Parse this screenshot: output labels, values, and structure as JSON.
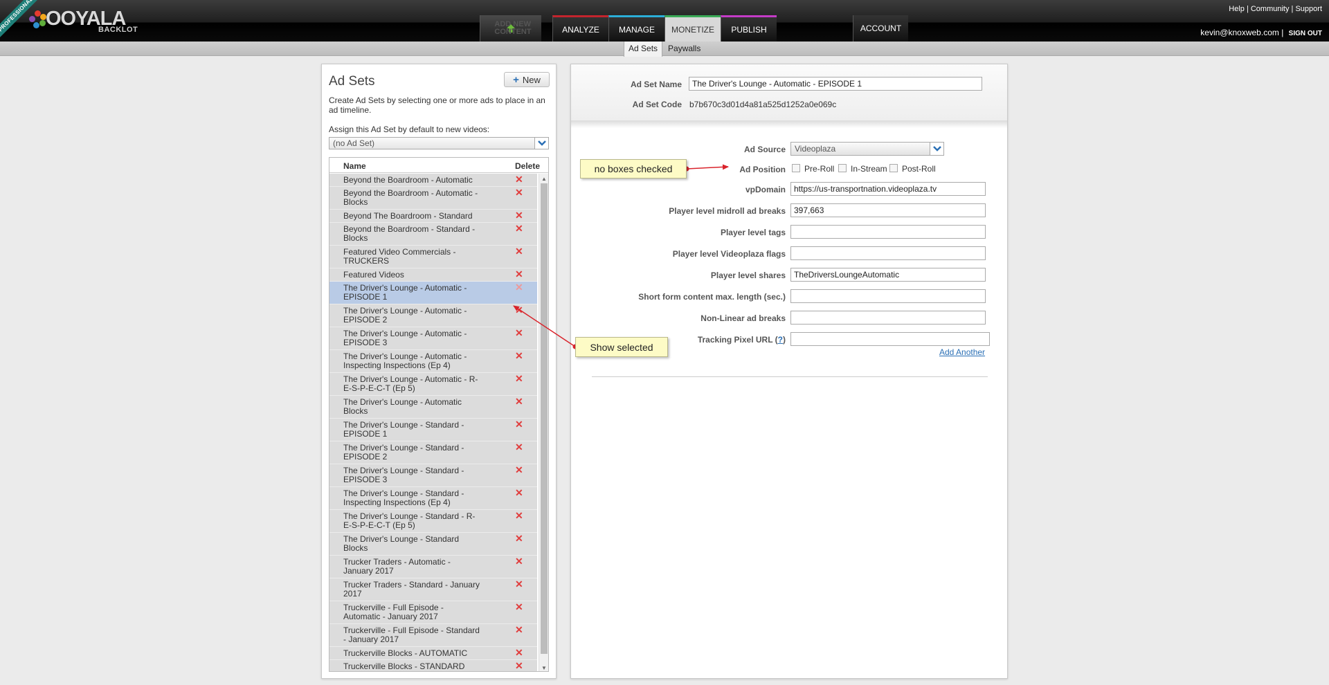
{
  "header": {
    "badge": "PROFESSIONAL",
    "logo_text": "OOYALA",
    "logo_sub": "BACKLOT",
    "util_links": [
      "Help",
      "Community",
      "Support"
    ],
    "user_email": "kevin@knoxweb.com",
    "sign_out": "SIGN OUT",
    "brand_colors": {
      "teal": "#1e7f78",
      "analyze": "#c4242d",
      "manage": "#2baed8",
      "monetize": "#3aa956",
      "publish": "#c43bc7"
    }
  },
  "nav": {
    "add_line1": "ADD NEW",
    "add_line2": "CONTENT",
    "analyze": "ANALYZE",
    "manage": "MANAGE",
    "monetize": "MONETIZE",
    "publish": "PUBLISH",
    "account": "ACCOUNT"
  },
  "subnav": {
    "tab_ad_sets": "Ad Sets",
    "tab_paywalls": "Paywalls"
  },
  "left": {
    "title": "Ad Sets",
    "new_label": "New",
    "description": "Create Ad Sets by selecting one or more ads to place in an ad timeline.",
    "assign_label": "Assign this Ad Set by default to new videos:",
    "assign_value": "(no Ad Set)",
    "col_name": "Name",
    "col_delete": "Delete",
    "delete_glyph": "✕",
    "items": [
      "Beyond the Boardroom - Automatic",
      "Beyond the Boardroom - Automatic - Blocks",
      "Beyond The Boardroom - Standard",
      "Beyond the Boardroom - Standard - Blocks",
      "Featured Video Commercials - TRUCKERS",
      "Featured Videos",
      "The Driver's Lounge - Automatic - EPISODE 1",
      "The Driver's Lounge - Automatic - EPISODE 2",
      "The Driver's Lounge - Automatic - EPISODE 3",
      "The Driver's Lounge - Automatic - Inspecting Inspections (Ep 4)",
      "The Driver's Lounge - Automatic - R-E-S-P-E-C-T (Ep 5)",
      "The Driver's Lounge - Automatic Blocks",
      "The Driver's Lounge - Standard - EPISODE 1",
      "The Driver's Lounge - Standard - EPISODE 2",
      "The Driver's Lounge - Standard - EPISODE 3",
      "The Driver's Lounge - Standard - Inspecting Inspections (Ep 4)",
      "The Driver's Lounge - Standard - R-E-S-P-E-C-T (Ep 5)",
      "The Driver's Lounge - Standard Blocks",
      "Trucker Traders - Automatic - January 2017",
      "Trucker Traders - Standard - January 2017",
      "Truckerville - Full Episode - Automatic - January 2017",
      "Truckerville - Full Episode - Standard - January 2017",
      "Truckerville Blocks - AUTOMATIC",
      "Truckerville Blocks - STANDARD"
    ],
    "selected_index": 6
  },
  "form": {
    "ad_set_name_label": "Ad Set Name",
    "ad_set_name_value": "The Driver's Lounge - Automatic - EPISODE 1",
    "ad_set_code_label": "Ad Set Code",
    "ad_set_code_value": "b7b670c3d01d4a81a525d1252a0e069c",
    "ad_source_label": "Ad Source",
    "ad_source_value": "Videoplaza",
    "ad_position_label": "Ad Position",
    "pre_roll": "Pre-Roll",
    "in_stream": "In-Stream",
    "post_roll": "Post-Roll",
    "vpdomain_label": "vpDomain",
    "vpdomain_value": "https://us-transportnation.videoplaza.tv",
    "midroll_label": "Player level midroll ad breaks",
    "midroll_value": "397,663",
    "tags_label": "Player level tags",
    "tags_value": "",
    "flags_label": "Player level Videoplaza flags",
    "flags_value": "",
    "shares_label": "Player level shares",
    "shares_value": "TheDriversLoungeAutomatic",
    "shortform_label": "Short form content max. length (sec.)",
    "shortform_value": "",
    "nonlinear_label": "Non-Linear ad breaks",
    "nonlinear_value": "",
    "tracking_label": "Tracking Pixel URL (",
    "tracking_q": "?",
    "tracking_close": ")",
    "tracking_value": "",
    "add_another": "Add Another"
  },
  "annotations": {
    "callout1": "no boxes checked",
    "callout2": "Show selected",
    "arrow_color": "#d9232b"
  }
}
